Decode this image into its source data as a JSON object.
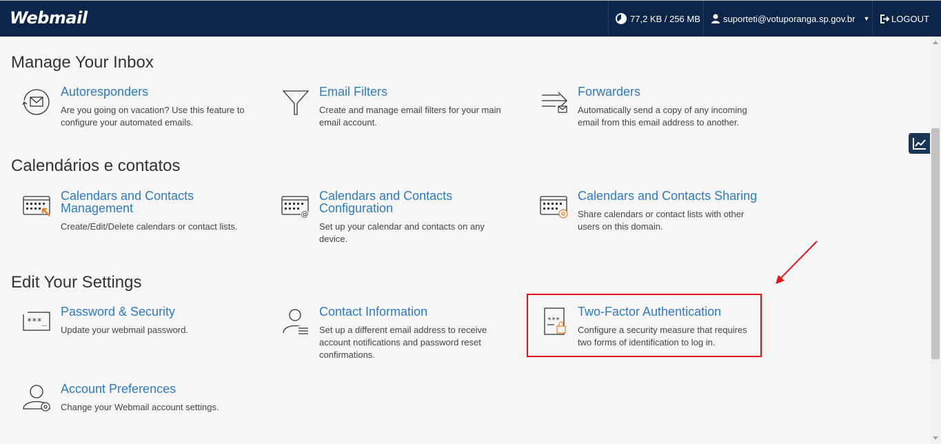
{
  "header": {
    "logo": "Webmail",
    "quota": "77,2 KB / 256 MB",
    "user": "suporteti@votuporanga.sp.gov.br",
    "logout": "LOGOUT"
  },
  "sections": {
    "inbox": {
      "title": "Manage Your Inbox",
      "autoresponders": {
        "name": "Autoresponders",
        "line1": "Are you going on vacation? Use this feature to",
        "line2": "configure your automated emails."
      },
      "filters": {
        "name": "Email Filters",
        "line1": "Create and manage email filters for your main",
        "line2": "email account."
      },
      "forwarders": {
        "name": "Forwarders",
        "line1": "Automatically send a copy of any incoming",
        "line2": "email from this email address to another."
      }
    },
    "calendars": {
      "title": "Calendários e contatos",
      "management": {
        "name1": "Calendars and Contacts",
        "name2": "Management",
        "line1": "Create/Edit/Delete calendars or contact lists."
      },
      "configuration": {
        "name1": "Calendars and Contacts",
        "name2": "Configuration",
        "line1": "Set up your calendar and contacts on any",
        "line2": "device."
      },
      "sharing": {
        "name": "Calendars and Contacts Sharing",
        "line1": "Share calendars or contact lists with other",
        "line2": "users on this domain."
      }
    },
    "settings": {
      "title": "Edit Your Settings",
      "password": {
        "name": "Password & Security",
        "line1": "Update your webmail password."
      },
      "contact": {
        "name": "Contact Information",
        "line1": "Set up a different email address to receive",
        "line2": "account notifications and password reset",
        "line3": "confirmations."
      },
      "twofactor": {
        "name": "Two-Factor Authentication",
        "line1": "Configure a security measure that requires",
        "line2": "two forms of identification to log in."
      },
      "preferences": {
        "name": "Account Preferences",
        "line1": "Change your Webmail account settings."
      }
    }
  },
  "icons": {
    "quota": "pie-chart-icon",
    "user": "user-icon",
    "logout": "logout-icon",
    "stats": "stats-chart-icon"
  },
  "colors": {
    "header_bg": "#0d2549",
    "link": "#2f7bbf",
    "highlight": "#e2141a",
    "accent_orange": "#f07c1b"
  }
}
